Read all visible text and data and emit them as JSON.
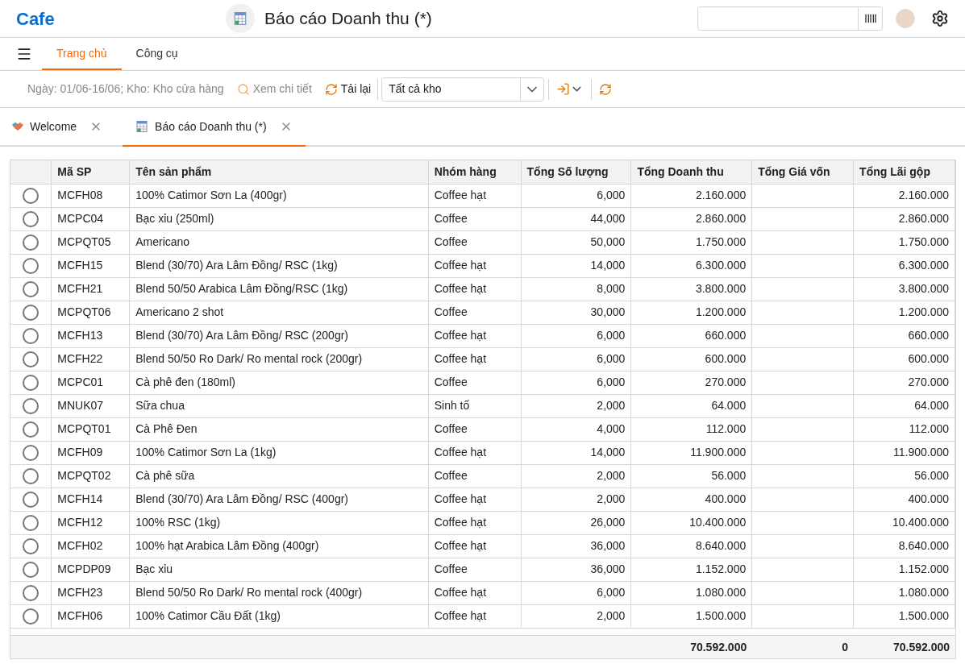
{
  "app": {
    "logo": "Cafe",
    "title": "Báo cáo Doanh thu (*)"
  },
  "menu_tabs": [
    {
      "label": "Trang chủ",
      "selected": true
    },
    {
      "label": "Công cụ",
      "selected": false
    }
  ],
  "toolbar": {
    "filter_summary": "Ngày: 01/06-16/06; Kho: Kho cửa hàng",
    "details": {
      "label": "Xem chi tiết",
      "disabled": true
    },
    "reload": "Tải lại",
    "warehouse": "Tất cả kho"
  },
  "doc_tabs": [
    {
      "label": "Welcome",
      "selected": false
    },
    {
      "label": "Báo cáo Doanh thu (*)",
      "selected": true
    }
  ],
  "table": {
    "columns": [
      "Mã SP",
      "Tên sản phẩm",
      "Nhóm hàng",
      "Tổng Số lượng",
      "Tổng Doanh thu",
      "Tổng Giá vốn",
      "Tổng Lãi gộp"
    ],
    "rows": [
      {
        "selected": false,
        "cells": [
          "MCFH08",
          "100% Catimor Sơn La (400gr)",
          "Coffee hạt",
          "6,000",
          "2.160.000",
          "",
          "2.160.000"
        ]
      },
      {
        "selected": false,
        "cells": [
          "MCPC04",
          "Bạc xỉu (250ml)",
          "Coffee",
          "44,000",
          "2.860.000",
          "",
          "2.860.000"
        ]
      },
      {
        "selected": false,
        "cells": [
          "MCPQT05",
          "Americano",
          "Coffee",
          "50,000",
          "1.750.000",
          "",
          "1.750.000"
        ]
      },
      {
        "selected": false,
        "cells": [
          "MCFH15",
          "Blend (30/70) Ara Lâm Đồng/ RSC (1kg)",
          "Coffee hạt",
          "14,000",
          "6.300.000",
          "",
          "6.300.000"
        ]
      },
      {
        "selected": false,
        "cells": [
          "MCFH21",
          "Blend 50/50 Arabica Lâm Đồng/RSC (1kg)",
          "Coffee hạt",
          "8,000",
          "3.800.000",
          "",
          "3.800.000"
        ]
      },
      {
        "selected": false,
        "cells": [
          "MCPQT06",
          "Americano 2 shot",
          "Coffee",
          "30,000",
          "1.200.000",
          "",
          "1.200.000"
        ]
      },
      {
        "selected": false,
        "cells": [
          "MCFH13",
          "Blend (30/70) Ara Lâm Đồng/ RSC (200gr)",
          "Coffee hạt",
          "6,000",
          "660.000",
          "",
          "660.000"
        ]
      },
      {
        "selected": false,
        "cells": [
          "MCFH22",
          "Blend 50/50 Ro Dark/ Ro mental rock (200gr)",
          "Coffee hạt",
          "6,000",
          "600.000",
          "",
          "600.000"
        ]
      },
      {
        "selected": false,
        "cells": [
          "MCPC01",
          "Cà phê đen (180ml)",
          "Coffee",
          "6,000",
          "270.000",
          "",
          "270.000"
        ]
      },
      {
        "selected": false,
        "cells": [
          "MNUK07",
          "Sữa chua",
          "Sinh tố",
          "2,000",
          "64.000",
          "",
          "64.000"
        ]
      },
      {
        "selected": false,
        "cells": [
          "MCPQT01",
          "Cà Phê Đen",
          "Coffee",
          "4,000",
          "112.000",
          "",
          "112.000"
        ]
      },
      {
        "selected": false,
        "cells": [
          "MCFH09",
          "100% Catimor Sơn La (1kg)",
          "Coffee hạt",
          "14,000",
          "11.900.000",
          "",
          "11.900.000"
        ]
      },
      {
        "selected": false,
        "cells": [
          "MCPQT02",
          "Cà phê sữa",
          "Coffee",
          "2,000",
          "56.000",
          "",
          "56.000"
        ]
      },
      {
        "selected": false,
        "cells": [
          "MCFH14",
          "Blend (30/70) Ara Lâm Đồng/ RSC (400gr)",
          "Coffee hạt",
          "2,000",
          "400.000",
          "",
          "400.000"
        ]
      },
      {
        "selected": false,
        "cells": [
          "MCFH12",
          "100% RSC (1kg)",
          "Coffee hạt",
          "26,000",
          "10.400.000",
          "",
          "10.400.000"
        ]
      },
      {
        "selected": false,
        "cells": [
          "MCFH02",
          "100% hạt Arabica Lâm Đồng (400gr)",
          "Coffee hạt",
          "36,000",
          "8.640.000",
          "",
          "8.640.000"
        ]
      },
      {
        "selected": false,
        "cells": [
          "MCPDP09",
          "Bạc xỉu",
          "Coffee",
          "36,000",
          "1.152.000",
          "",
          "1.152.000"
        ]
      },
      {
        "selected": false,
        "cells": [
          "MCFH23",
          "Blend 50/50 Ro Dark/ Ro mental rock (400gr)",
          "Coffee hạt",
          "6,000",
          "1.080.000",
          "",
          "1.080.000"
        ]
      },
      {
        "selected": false,
        "cells": [
          "MCFH06",
          "100% Catimor Cầu Đất (1kg)",
          "Coffee hạt",
          "2,000",
          "1.500.000",
          "",
          "1.500.000"
        ]
      }
    ],
    "totals": {
      "revenue": "70.592.000",
      "cost": "0",
      "profit": "70.592.000"
    }
  }
}
